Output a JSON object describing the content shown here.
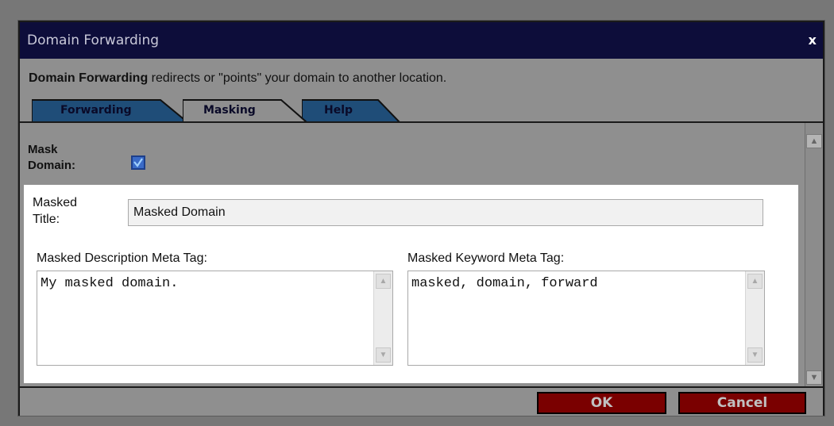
{
  "dialog": {
    "title": "Domain Forwarding",
    "close_label": "x",
    "intro_bold": "Domain Forwarding",
    "intro_rest": " redirects or \"points\" your domain to another location."
  },
  "tabs": [
    {
      "label": "Forwarding",
      "active": false,
      "color": "#1f4d78"
    },
    {
      "label": "Masking",
      "active": true,
      "color": "#8f8f8f"
    },
    {
      "label": "Help",
      "active": false,
      "color": "#1f4d78"
    }
  ],
  "form": {
    "mask_domain_label": "Mask Domain:",
    "mask_domain_checked": true,
    "masked_title_label": "Masked Title:",
    "masked_title_value": "Masked Domain",
    "description_label": "Masked Description Meta Tag:",
    "description_value": "My masked domain.",
    "keyword_label": "Masked Keyword Meta Tag:",
    "keyword_value": "masked, domain, forward"
  },
  "footer": {
    "ok_label": "OK",
    "cancel_label": "Cancel"
  },
  "colors": {
    "title_bar": "#0d0d3a",
    "tab_inactive": "#1f4d78",
    "button": "#7a0000"
  }
}
